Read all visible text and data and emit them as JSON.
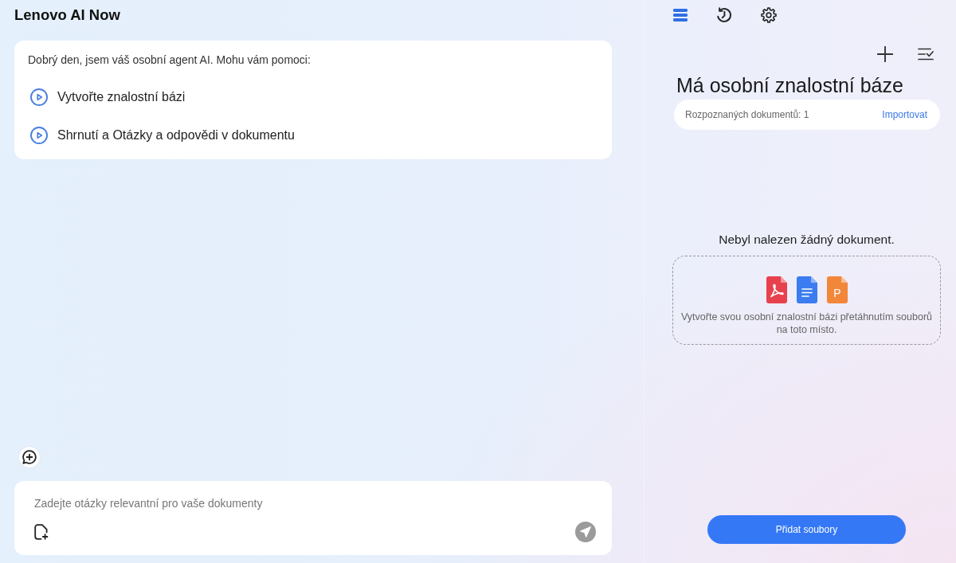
{
  "app": {
    "title": "Lenovo AI Now"
  },
  "chat": {
    "greeting": "Dobrý den, jsem váš osobní agent AI. Mohu vám pomoci:",
    "suggestions": [
      "Vytvořte znalostní bázi",
      "Shrnutí a Otázky a odpovědi v dokumentu"
    ]
  },
  "composer": {
    "placeholder": "Zadejte otázky relevantní pro vaše dokumenty",
    "send_button": {
      "disabled": true
    }
  },
  "toolbar": [
    {
      "kind": "menu",
      "selected": true
    },
    {
      "kind": "history",
      "selected": false
    },
    {
      "kind": "settings",
      "selected": false
    }
  ],
  "knowledge_base": {
    "title": "Má osobní znalostní báze",
    "count_label": "Rozpoznaných dokumentů: 1",
    "import_link": "Importovat",
    "empty_message": "Nebyl nalezen žádný dokument.",
    "file_types": [
      {
        "kind": "pdf"
      },
      {
        "kind": "doc"
      },
      {
        "kind": "ppt",
        "label": "P"
      }
    ],
    "drop_hint": "Vytvořte svou osobní znalostní bázi přetáhnutím souborů na toto místo.",
    "add_button": "Přidat soubory"
  }
}
